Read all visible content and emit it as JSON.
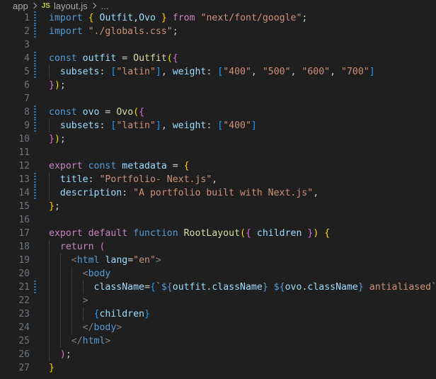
{
  "breadcrumb": {
    "folder": "app",
    "file_type": "JS",
    "file": "layout.js",
    "more": "..."
  },
  "lines": [
    {
      "n": "1",
      "mod": true,
      "indent": 0,
      "tokens": [
        [
          "kw",
          "import"
        ],
        [
          "punc",
          " "
        ],
        [
          "br1",
          "{"
        ],
        [
          "punc",
          " "
        ],
        [
          "var",
          "Outfit"
        ],
        [
          "punc",
          ","
        ],
        [
          "var",
          "Ovo"
        ],
        [
          "punc",
          " "
        ],
        [
          "br1",
          "}"
        ],
        [
          "punc",
          " "
        ],
        [
          "ctrl",
          "from"
        ],
        [
          "punc",
          " "
        ],
        [
          "str",
          "\"next/font/google\""
        ],
        [
          "punc",
          ";"
        ]
      ]
    },
    {
      "n": "2",
      "mod": true,
      "indent": 0,
      "tokens": [
        [
          "kw",
          "import"
        ],
        [
          "punc",
          " "
        ],
        [
          "str",
          "\"./globals.css\""
        ],
        [
          "punc",
          ";"
        ]
      ]
    },
    {
      "n": "3",
      "mod": false,
      "indent": 0,
      "tokens": []
    },
    {
      "n": "4",
      "mod": true,
      "indent": 0,
      "tokens": [
        [
          "kw",
          "const"
        ],
        [
          "punc",
          " "
        ],
        [
          "var",
          "outfit"
        ],
        [
          "punc",
          " = "
        ],
        [
          "fn",
          "Outfit"
        ],
        [
          "br1",
          "("
        ],
        [
          "br2",
          "{"
        ]
      ]
    },
    {
      "n": "5",
      "mod": true,
      "indent": 1,
      "tokens": [
        [
          "punc",
          "  "
        ],
        [
          "var",
          "subsets"
        ],
        [
          "punc",
          ": "
        ],
        [
          "br3",
          "["
        ],
        [
          "str",
          "\"latin\""
        ],
        [
          "br3",
          "]"
        ],
        [
          "punc",
          ", "
        ],
        [
          "var",
          "weight"
        ],
        [
          "punc",
          ": "
        ],
        [
          "br3",
          "["
        ],
        [
          "str",
          "\"400\""
        ],
        [
          "punc",
          ", "
        ],
        [
          "str",
          "\"500\""
        ],
        [
          "punc",
          ", "
        ],
        [
          "str",
          "\"600\""
        ],
        [
          "punc",
          ", "
        ],
        [
          "str",
          "\"700\""
        ],
        [
          "br3",
          "]"
        ]
      ]
    },
    {
      "n": "6",
      "mod": false,
      "indent": 0,
      "tokens": [
        [
          "br2",
          "}"
        ],
        [
          "br1",
          ")"
        ],
        [
          "punc",
          ";"
        ]
      ]
    },
    {
      "n": "7",
      "mod": false,
      "indent": 0,
      "tokens": []
    },
    {
      "n": "8",
      "mod": true,
      "indent": 0,
      "tokens": [
        [
          "kw",
          "const"
        ],
        [
          "punc",
          " "
        ],
        [
          "var",
          "ovo"
        ],
        [
          "punc",
          " = "
        ],
        [
          "fn",
          "Ovo"
        ],
        [
          "br1",
          "("
        ],
        [
          "br2",
          "{"
        ]
      ]
    },
    {
      "n": "9",
      "mod": true,
      "indent": 1,
      "tokens": [
        [
          "punc",
          "  "
        ],
        [
          "var",
          "subsets"
        ],
        [
          "punc",
          ": "
        ],
        [
          "br3",
          "["
        ],
        [
          "str",
          "\"latin\""
        ],
        [
          "br3",
          "]"
        ],
        [
          "punc",
          ", "
        ],
        [
          "var",
          "weight"
        ],
        [
          "punc",
          ": "
        ],
        [
          "br3",
          "["
        ],
        [
          "str",
          "\"400\""
        ],
        [
          "br3",
          "]"
        ]
      ]
    },
    {
      "n": "10",
      "mod": false,
      "indent": 0,
      "tokens": [
        [
          "br2",
          "}"
        ],
        [
          "br1",
          ")"
        ],
        [
          "punc",
          ";"
        ]
      ]
    },
    {
      "n": "11",
      "mod": false,
      "indent": 0,
      "tokens": []
    },
    {
      "n": "12",
      "mod": false,
      "indent": 0,
      "tokens": [
        [
          "ctrl",
          "export"
        ],
        [
          "punc",
          " "
        ],
        [
          "kw",
          "const"
        ],
        [
          "punc",
          " "
        ],
        [
          "var",
          "metadata"
        ],
        [
          "punc",
          " = "
        ],
        [
          "br1",
          "{"
        ]
      ]
    },
    {
      "n": "13",
      "mod": true,
      "indent": 1,
      "tokens": [
        [
          "punc",
          "  "
        ],
        [
          "var",
          "title"
        ],
        [
          "punc",
          ": "
        ],
        [
          "str",
          "\"Portfolio- Next.js\""
        ],
        [
          "punc",
          ","
        ]
      ]
    },
    {
      "n": "14",
      "mod": true,
      "indent": 1,
      "tokens": [
        [
          "punc",
          "  "
        ],
        [
          "var",
          "description"
        ],
        [
          "punc",
          ": "
        ],
        [
          "str",
          "\"A portfolio built with Next.js\""
        ],
        [
          "punc",
          ","
        ]
      ]
    },
    {
      "n": "15",
      "mod": false,
      "indent": 0,
      "tokens": [
        [
          "br1",
          "}"
        ],
        [
          "punc",
          ";"
        ]
      ]
    },
    {
      "n": "16",
      "mod": false,
      "indent": 0,
      "tokens": []
    },
    {
      "n": "17",
      "mod": false,
      "indent": 0,
      "tokens": [
        [
          "ctrl",
          "export"
        ],
        [
          "punc",
          " "
        ],
        [
          "ctrl",
          "default"
        ],
        [
          "punc",
          " "
        ],
        [
          "kw",
          "function"
        ],
        [
          "punc",
          " "
        ],
        [
          "fn",
          "RootLayout"
        ],
        [
          "br1",
          "("
        ],
        [
          "br2",
          "{"
        ],
        [
          "punc",
          " "
        ],
        [
          "var",
          "children"
        ],
        [
          "punc",
          " "
        ],
        [
          "br2",
          "}"
        ],
        [
          "br1",
          ")"
        ],
        [
          "punc",
          " "
        ],
        [
          "br1",
          "{"
        ]
      ]
    },
    {
      "n": "18",
      "mod": false,
      "indent": 1,
      "tokens": [
        [
          "punc",
          "  "
        ],
        [
          "ctrl",
          "return"
        ],
        [
          "punc",
          " "
        ],
        [
          "br2",
          "("
        ]
      ]
    },
    {
      "n": "19",
      "mod": false,
      "indent": 2,
      "tokens": [
        [
          "punc",
          "    "
        ],
        [
          "angle",
          "<"
        ],
        [
          "tag",
          "html"
        ],
        [
          "punc",
          " "
        ],
        [
          "attr",
          "lang"
        ],
        [
          "punc",
          "="
        ],
        [
          "str",
          "\"en\""
        ],
        [
          "angle",
          ">"
        ]
      ]
    },
    {
      "n": "20",
      "mod": false,
      "indent": 3,
      "tokens": [
        [
          "punc",
          "      "
        ],
        [
          "angle",
          "<"
        ],
        [
          "tag",
          "body"
        ]
      ]
    },
    {
      "n": "21",
      "mod": true,
      "indent": 4,
      "tokens": [
        [
          "punc",
          "        "
        ],
        [
          "attr",
          "className"
        ],
        [
          "punc",
          "="
        ],
        [
          "br3",
          "{"
        ],
        [
          "str",
          "`"
        ],
        [
          "kw",
          "${"
        ],
        [
          "var",
          "outfit"
        ],
        [
          "punc",
          "."
        ],
        [
          "var",
          "className"
        ],
        [
          "kw",
          "}"
        ],
        [
          "str",
          " "
        ],
        [
          "kw",
          "${"
        ],
        [
          "var",
          "ovo"
        ],
        [
          "punc",
          "."
        ],
        [
          "var",
          "className"
        ],
        [
          "kw",
          "}"
        ],
        [
          "str",
          " antialiased`"
        ],
        [
          "br3",
          "}"
        ]
      ]
    },
    {
      "n": "22",
      "mod": false,
      "indent": 3,
      "tokens": [
        [
          "punc",
          "      "
        ],
        [
          "angle",
          ">"
        ]
      ]
    },
    {
      "n": "23",
      "mod": false,
      "indent": 4,
      "tokens": [
        [
          "punc",
          "        "
        ],
        [
          "br3",
          "{"
        ],
        [
          "var",
          "children"
        ],
        [
          "br3",
          "}"
        ]
      ]
    },
    {
      "n": "24",
      "mod": false,
      "indent": 3,
      "tokens": [
        [
          "punc",
          "      "
        ],
        [
          "angle",
          "</"
        ],
        [
          "tag",
          "body"
        ],
        [
          "angle",
          ">"
        ]
      ]
    },
    {
      "n": "25",
      "mod": false,
      "indent": 2,
      "tokens": [
        [
          "punc",
          "    "
        ],
        [
          "angle",
          "</"
        ],
        [
          "tag",
          "html"
        ],
        [
          "angle",
          ">"
        ]
      ]
    },
    {
      "n": "26",
      "mod": false,
      "indent": 1,
      "tokens": [
        [
          "punc",
          "  "
        ],
        [
          "br2",
          ")"
        ],
        [
          "punc",
          ";"
        ]
      ]
    },
    {
      "n": "27",
      "mod": false,
      "indent": 0,
      "tokens": [
        [
          "br1",
          "}"
        ]
      ]
    }
  ]
}
